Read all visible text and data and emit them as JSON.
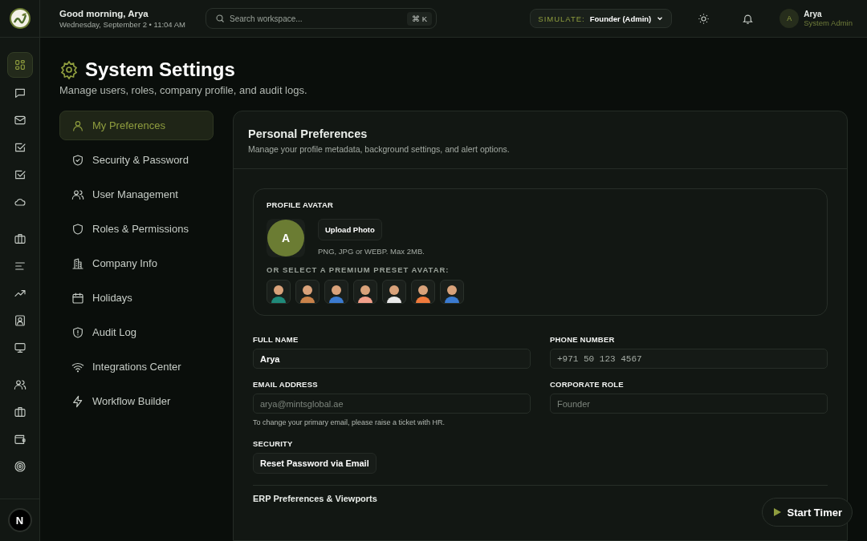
{
  "rail": {
    "items": [
      {
        "kind": "grid",
        "selected": true
      },
      {
        "kind": "chat",
        "selected": false
      },
      {
        "kind": "mail",
        "selected": false
      },
      {
        "kind": "check",
        "selected": false
      },
      {
        "kind": "check",
        "selected": false
      },
      {
        "kind": "cloud",
        "selected": false
      },
      {
        "kind": "briefcase",
        "selected": false
      },
      {
        "kind": "lines",
        "selected": false
      },
      {
        "kind": "trend",
        "selected": false
      },
      {
        "kind": "contact",
        "selected": false
      },
      {
        "kind": "monitor",
        "selected": false
      },
      {
        "kind": "users",
        "selected": false
      },
      {
        "kind": "briefcase",
        "selected": false
      },
      {
        "kind": "wallet",
        "selected": false
      },
      {
        "kind": "target",
        "selected": false
      }
    ],
    "footer_avatar": "N"
  },
  "header": {
    "greeting": "Good morning, Arya",
    "date": "Wednesday, September 2 • 11:04 AM",
    "search": {
      "placeholder": "Search workspace...",
      "shortcut": "⌘ K"
    },
    "simulate": {
      "label": "SIMULATE:",
      "value": "Founder (Admin)"
    },
    "user": {
      "initial": "A",
      "name": "Arya",
      "role": "System Admin"
    }
  },
  "page": {
    "title": "System Settings",
    "subtitle": "Manage users, roles, company profile, and audit logs."
  },
  "settings_nav": [
    {
      "label": "My Preferences",
      "kind": "user",
      "selected": true
    },
    {
      "label": "Security & Password",
      "kind": "shield-check",
      "selected": false
    },
    {
      "label": "User Management",
      "kind": "users",
      "selected": false
    },
    {
      "label": "Roles & Permissions",
      "kind": "shield",
      "selected": false
    },
    {
      "label": "Company Info",
      "kind": "building",
      "selected": false
    },
    {
      "label": "Holidays",
      "kind": "calendar",
      "selected": false
    },
    {
      "label": "Audit Log",
      "kind": "shield-alert",
      "selected": false
    },
    {
      "label": "Integrations Center",
      "kind": "wifi",
      "selected": false
    },
    {
      "label": "Workflow Builder",
      "kind": "bolt",
      "selected": false
    }
  ],
  "panel": {
    "title": "Personal Preferences",
    "subtitle": "Manage your profile metadata, background settings, and alert options.",
    "avatar_section": {
      "heading": "PROFILE AVATAR",
      "initial": "A",
      "upload_button": "Upload Photo",
      "hint": "PNG, JPG or WEBP. Max 2MB.",
      "preset_heading": "OR SELECT A PREMIUM PRESET AVATAR:",
      "presets": [
        {
          "color": "#1f8a7a"
        },
        {
          "color": "#c9824a"
        },
        {
          "color": "#3b7bd0"
        },
        {
          "color": "#f2a08a"
        },
        {
          "color": "#e8e8e8"
        },
        {
          "color": "#f07a3c"
        },
        {
          "color": "#3b7bd0"
        }
      ]
    },
    "fields": [
      {
        "label": "FULL NAME",
        "value": "Arya",
        "disabled": false,
        "mono": false
      },
      {
        "label": "PHONE NUMBER",
        "value": "+971 50 123 4567",
        "disabled": false,
        "mono": true
      },
      {
        "label": "EMAIL ADDRESS",
        "value": "arya@mintsglobal.ae",
        "disabled": true,
        "mono": false,
        "note": "To change your primary email, please raise a ticket with HR."
      },
      {
        "label": "CORPORATE ROLE",
        "value": "Founder",
        "disabled": true,
        "mono": false
      }
    ],
    "security": {
      "heading": "SECURITY",
      "button": "Reset Password via Email"
    },
    "next_section": "ERP Preferences & Viewports"
  },
  "timer_button": "Start Timer"
}
